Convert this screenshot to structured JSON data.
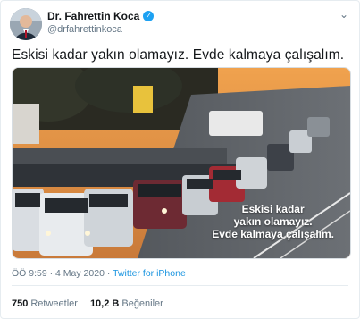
{
  "user": {
    "display_name": "Dr. Fahrettin Koca",
    "handle": "@drfahrettinkoca",
    "verified_icon": "verified-badge-icon"
  },
  "tweet": {
    "text": "Eskisi kadar yakın olamayız. Evde kalmaya çalışalım."
  },
  "media": {
    "overlay_lines": [
      "Eskisi kadar",
      "yakın olamayız.",
      "Evde kalmaya çalışalım."
    ]
  },
  "meta": {
    "time": "ÖÖ 9:59",
    "separator": "·",
    "date": "4 May 2020",
    "source": "Twitter for iPhone"
  },
  "stats": {
    "retweets_count": "750",
    "retweets_label": "Retweetler",
    "likes_count": "10,2 B",
    "likes_label": "Beğeniler"
  },
  "colors": {
    "link": "#1b95e0",
    "verified": "#1da1f2",
    "muted": "#657786"
  }
}
